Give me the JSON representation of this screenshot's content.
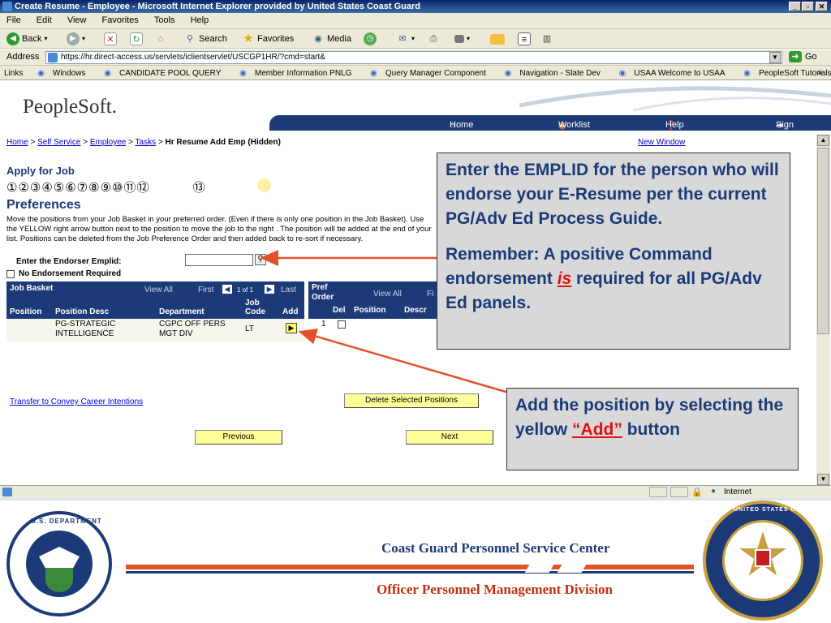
{
  "window": {
    "title": "Create Resume - Employee - Microsoft Internet Explorer provided by United States Coast Guard"
  },
  "menu": [
    "File",
    "Edit",
    "View",
    "Favorites",
    "Tools",
    "Help"
  ],
  "toolbar": {
    "back": "Back",
    "search": "Search",
    "favorites": "Favorites",
    "media": "Media"
  },
  "address": {
    "label": "Address",
    "url": "https://hr.direct-access.us/servlets/iclientservlet/USCGP1HR/?cmd=start&",
    "go": "Go"
  },
  "links": [
    "Links",
    "Windows",
    "CANDIDATE POOL QUERY",
    "Member Information PNLG",
    "Query Manager Component",
    "Navigation - Slate Dev",
    "USAA  Welcome to USAA",
    "PeopleSoft Tutorials"
  ],
  "ps": {
    "logo": "PeopleSoft.",
    "nav": {
      "home": "Home",
      "worklist": "Worklist",
      "help": "Help",
      "signout": "Sign Out"
    },
    "breadcrumb": {
      "home": "Home",
      "self_service": "Self Service",
      "employee": "Employee",
      "tasks": "Tasks",
      "current": "Hr Resume Add Emp (Hidden)"
    },
    "new_window": "New Window",
    "apply_title": "Apply for Job",
    "steps": "①②③④⑤⑥⑦⑧⑨⑩⑪⑫",
    "step13": "⑬",
    "preferences_title": "Preferences",
    "description": "Move the positions from your Job Basket in your preferred order. (Even if there is only one position in the Job Basket). Use the YELLOW right arrow button next to the position to move the job to the right . The position will be added at the end of your list. Positions can be deleted from the Job Preference Order and then added back to re-sort if necessary.",
    "endorser_label": "Enter the Endorser Emplid:",
    "no_endorsement": "No Endorsement Required",
    "job_basket": {
      "title": "Job Basket",
      "view_all": "View All",
      "first": "First",
      "count": "1 of 1",
      "last": "Last",
      "col_position": "Position",
      "col_desc": "Position Desc",
      "col_dept": "Department",
      "col_job": "Job",
      "col_code": "Code",
      "col_add": "Add",
      "row": {
        "desc1": "PG-STRATEGIC",
        "desc2": "INTELLIGENCE",
        "dept1": "CGPC OFF PERS",
        "dept2": "MGT DIV",
        "code": "LT"
      }
    },
    "pref_order": {
      "title1": "Pref",
      "title2": "Order",
      "view_all": "View All",
      "fi": "Fi",
      "col_del": "Del",
      "col_position": "Position",
      "col_descr": "Descr",
      "row_num": "1"
    },
    "transfer_link": "Transfer to Convey Career Intentions",
    "delete_btn": "Delete Selected Positions",
    "previous_btn": "Previous",
    "next_btn": "Next"
  },
  "status": {
    "zone": "Internet"
  },
  "callout1": {
    "p1": "Enter the EMPLID for the person who will endorse your E-Resume per the current PG/Adv Ed Process Guide.",
    "p2a": "Remember: A positive Command endorsement ",
    "p2b": "is",
    "p2c": " required for all PG/Adv Ed panels."
  },
  "callout2": {
    "a": "Add the position by selecting the  yellow ",
    "b": "“Add”",
    "c": " button"
  },
  "footer": {
    "center": "Coast Guard Personnel Service Center",
    "division": "Officer Personnel Management Division"
  },
  "seals": {
    "dhs": "U.S. DEPARTMENT OF HOMELAND SECURITY",
    "uscg": "UNITED STATES COAST GUARD PERSONNEL SERVICE CENTER"
  },
  "colors": {
    "ps_blue": "#1c3a78",
    "callout_text": "#1c3a78",
    "accent_red": "#e01010",
    "footer_orange": "#e2522a"
  }
}
